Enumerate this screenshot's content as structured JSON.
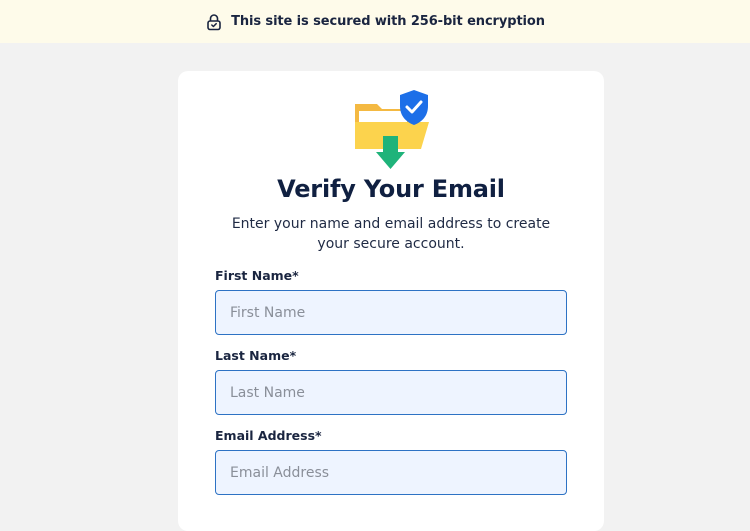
{
  "banner": {
    "icon": "lock-icon",
    "text": "This site is secured with 256-bit encryption"
  },
  "card": {
    "hero_icon": "secure-folder-download-icon",
    "title": "Verify Your Email",
    "subtitle": "Enter your name and email address to create your secure account."
  },
  "form": {
    "first_name": {
      "label": "First Name*",
      "placeholder": "First Name",
      "value": ""
    },
    "last_name": {
      "label": "Last Name*",
      "placeholder": "Last Name",
      "value": ""
    },
    "email": {
      "label": "Email Address*",
      "placeholder": "Email Address",
      "value": ""
    }
  },
  "colors": {
    "banner_bg": "#fefbea",
    "page_bg": "#f2f2f2",
    "input_border": "#2d72c4",
    "input_bg": "#eef4ff",
    "shield_blue": "#1d6fe8",
    "arrow_green": "#1fb37a",
    "folder_yellow": "#fcd34d"
  }
}
